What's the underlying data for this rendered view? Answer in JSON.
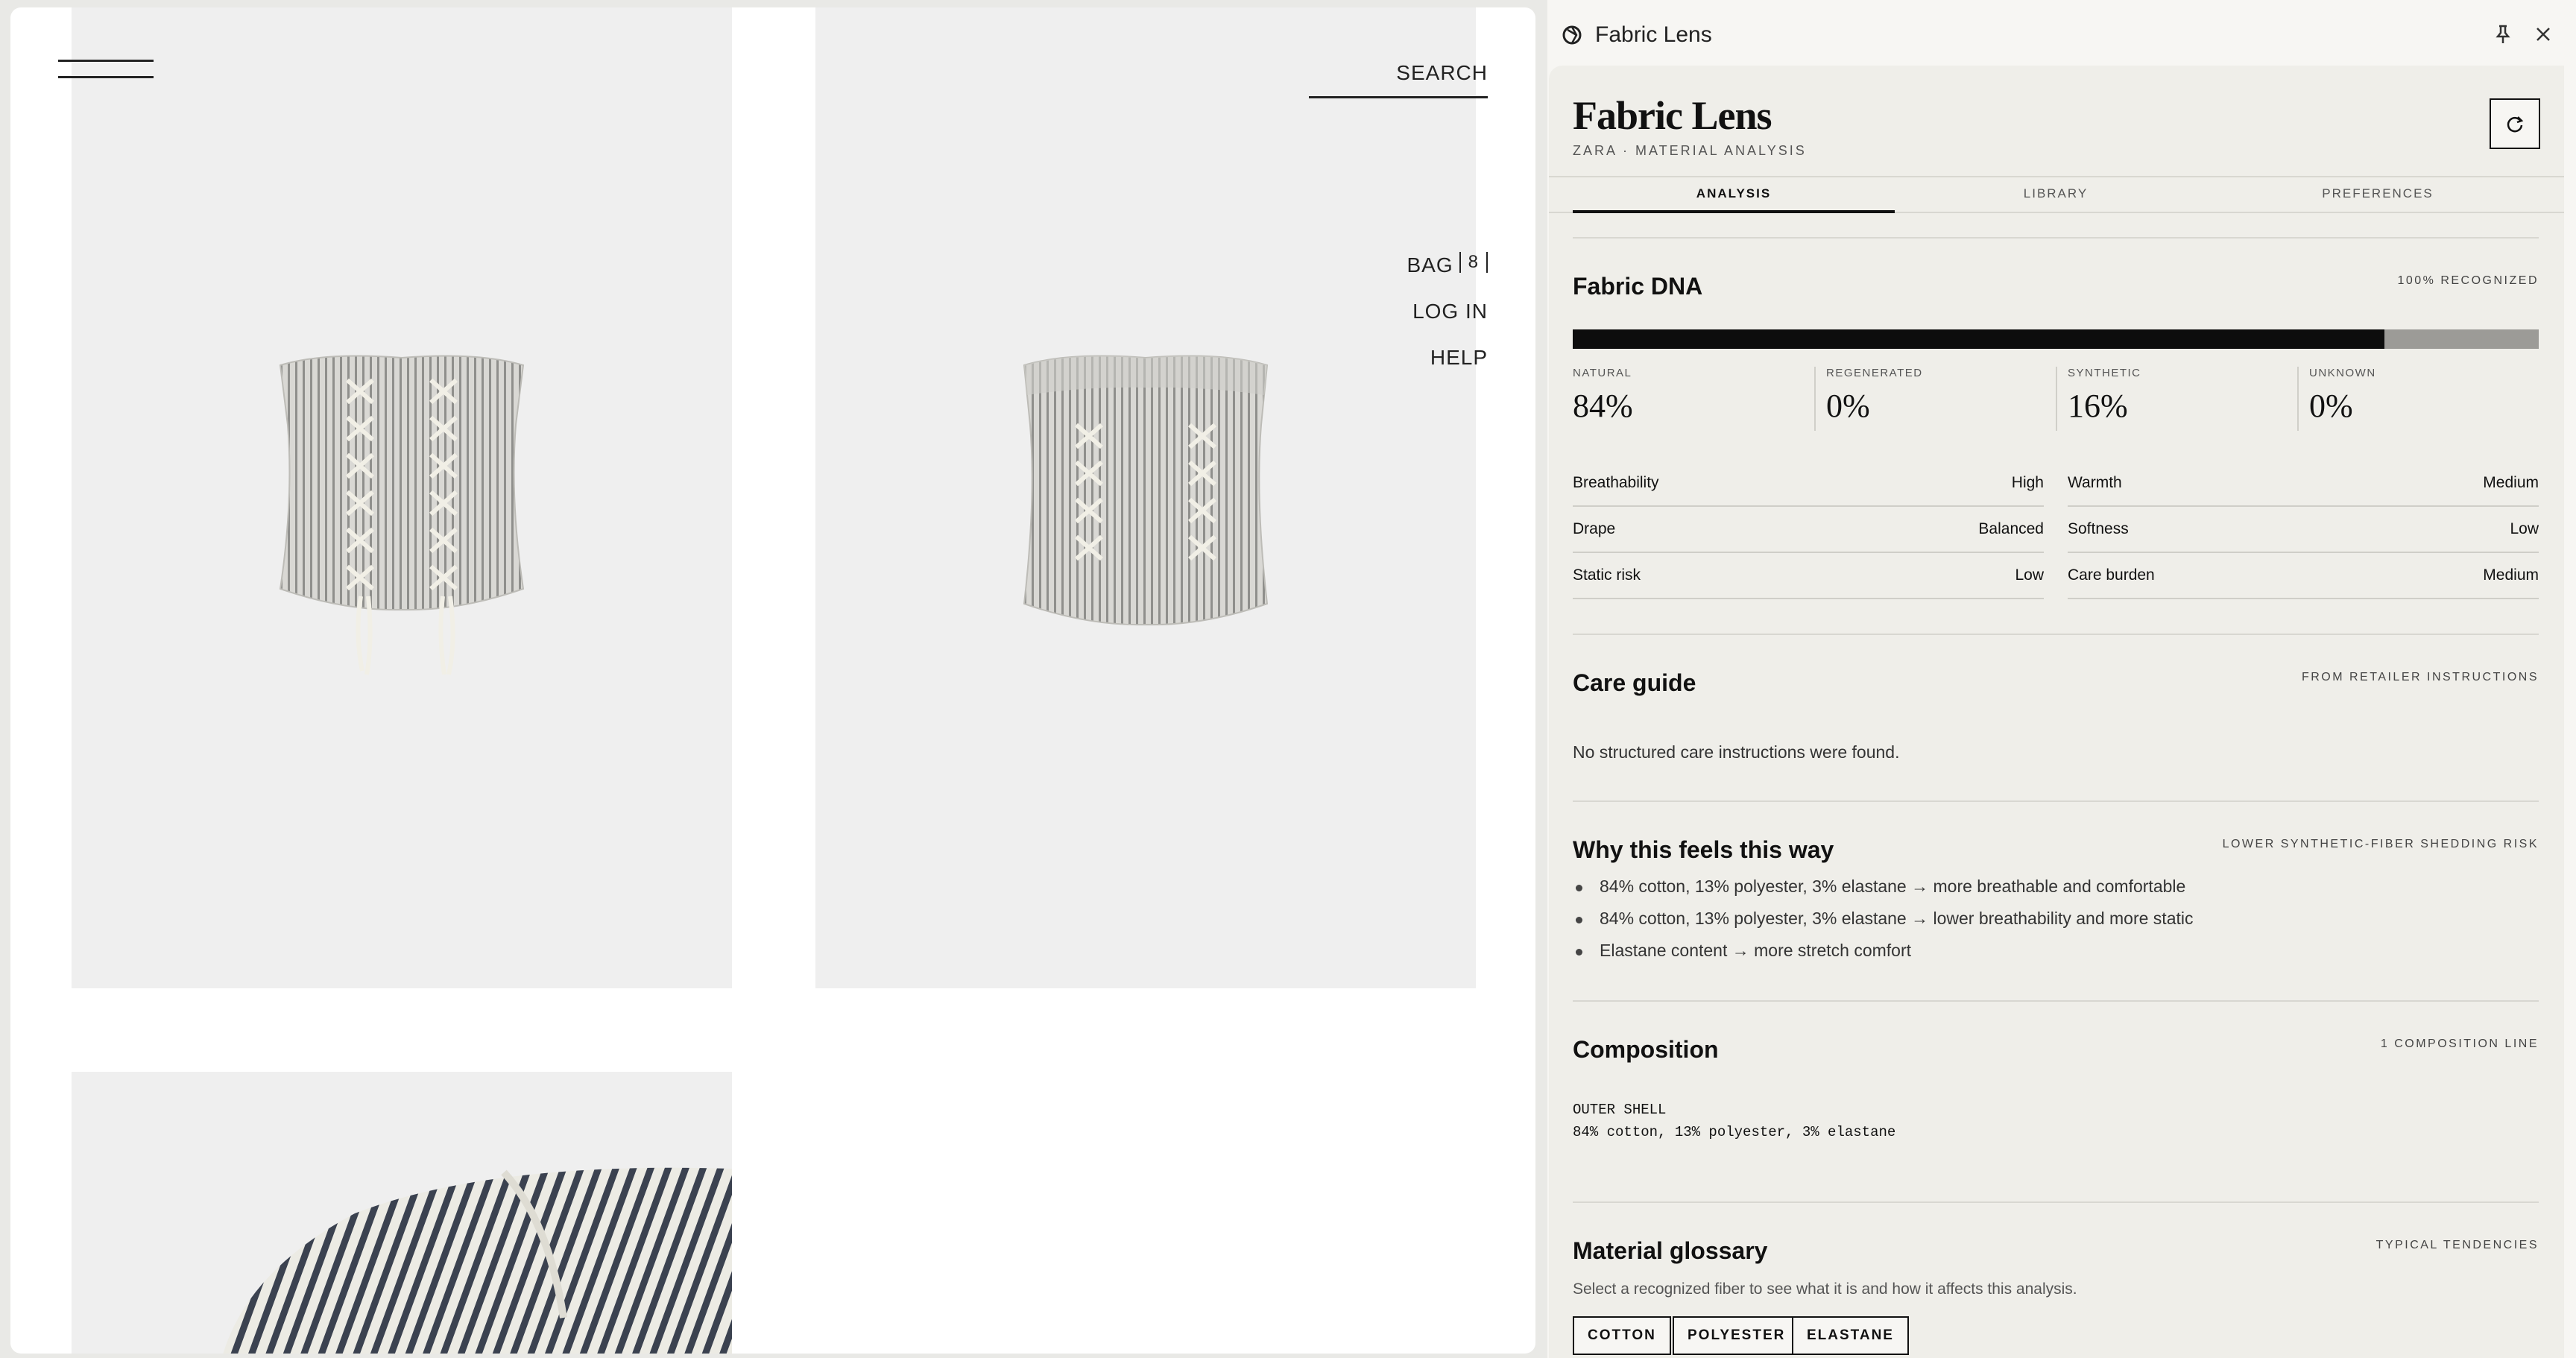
{
  "store": {
    "search_label": "SEARCH",
    "nav": {
      "bag": "BAG",
      "bag_count": "8",
      "login": "LOG IN",
      "help": "HELP"
    },
    "products": [
      {
        "name": "striped-lace-up-corset-top-front"
      },
      {
        "name": "striped-lace-up-corset-top-back"
      },
      {
        "name": "striped-fabric-detail"
      }
    ]
  },
  "panel": {
    "title": "Fabric Lens",
    "brand": "Fabric Lens",
    "subtitle": "ZARA · MATERIAL ANALYSIS",
    "tabs": [
      {
        "label": "ANALYSIS",
        "active": true
      },
      {
        "label": "LIBRARY",
        "active": false
      },
      {
        "label": "PREFERENCES",
        "active": false
      }
    ],
    "fabric_dna": {
      "title": "Fabric DNA",
      "tag": "100% RECOGNIZED",
      "fill_fraction": 0.84,
      "stats": [
        {
          "label": "NATURAL",
          "value": "84%"
        },
        {
          "label": "REGENERATED",
          "value": "0%"
        },
        {
          "label": "SYNTHETIC",
          "value": "16%"
        },
        {
          "label": "UNKNOWN",
          "value": "0%"
        }
      ],
      "properties": [
        {
          "key": "Breathability",
          "value": "High"
        },
        {
          "key": "Warmth",
          "value": "Medium"
        },
        {
          "key": "Drape",
          "value": "Balanced"
        },
        {
          "key": "Softness",
          "value": "Low"
        },
        {
          "key": "Static risk",
          "value": "Low"
        },
        {
          "key": "Care burden",
          "value": "Medium"
        }
      ]
    },
    "care_guide": {
      "title": "Care guide",
      "tag": "FROM RETAILER INSTRUCTIONS",
      "message": "No structured care instructions were found."
    },
    "why": {
      "title": "Why this feels this way",
      "tag": "LOWER SYNTHETIC-FIBER SHEDDING RISK",
      "bullets": [
        "84% cotton, 13% polyester, 3% elastane → more breathable and comfortable",
        "84% cotton, 13% polyester, 3% elastane → lower breathability and more static",
        "Elastane content → more stretch comfort"
      ]
    },
    "composition": {
      "title": "Composition",
      "tag": "1 COMPOSITION LINE",
      "part": "OUTER SHELL",
      "line": "84% cotton, 13% polyester, 3% elastane"
    },
    "glossary": {
      "title": "Material glossary",
      "tag": "TYPICAL TENDENCIES",
      "hint": "Select a recognized fiber to see what it is and how it affects this analysis.",
      "chips": [
        "COTTON",
        "POLYESTER",
        "ELASTANE"
      ]
    }
  },
  "colors": {
    "ink": "#111111",
    "panel_bg": "#efeee9",
    "bar_rest": "#9c9b97",
    "tile_bg": "#efefef"
  },
  "icons": [
    "menu-icon",
    "fabric-lens-logo-icon",
    "pin-icon",
    "close-icon",
    "refresh-icon"
  ]
}
